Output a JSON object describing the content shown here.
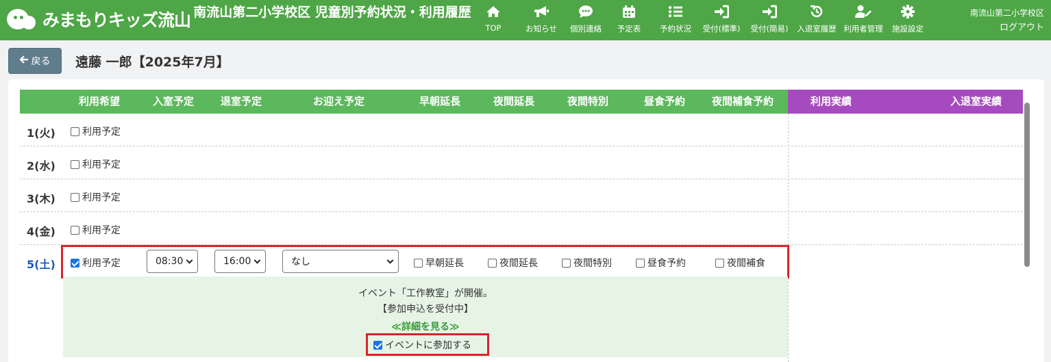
{
  "header": {
    "logo_text": "みまもりキッズ流山",
    "title": "南流山第二小学校区 児童別予約状況・利用履歴",
    "nav": [
      {
        "label": "TOP",
        "icon": "home-icon"
      },
      {
        "label": "お知らせ",
        "icon": "megaphone-icon"
      },
      {
        "label": "個別連絡",
        "icon": "chat-icon"
      },
      {
        "label": "予定表",
        "icon": "calendar-icon"
      },
      {
        "label": "予約状況",
        "icon": "list-icon"
      },
      {
        "label": "受付(標準)",
        "icon": "sign-in-icon"
      },
      {
        "label": "受付(簡易)",
        "icon": "sign-in-icon"
      },
      {
        "label": "入退室履歴",
        "icon": "history-icon"
      },
      {
        "label": "利用者管理",
        "icon": "user-edit-icon"
      },
      {
        "label": "施設設定",
        "icon": "gear-icon"
      }
    ],
    "user_area": "南流山第二小学校区",
    "logout": "ログアウト"
  },
  "back_button": "戻る",
  "page_title": "遠藤 一郎【2025年7月】",
  "table": {
    "columns": [
      "利用希望",
      "入室予定",
      "退室予定",
      "お迎え予定",
      "早朝延長",
      "夜間延長",
      "夜間特別",
      "昼食予約",
      "夜間補食予約",
      "利用実績",
      "入退室実績"
    ],
    "rows": [
      {
        "day": "1(火)",
        "checkbox_label": "利用予定",
        "checked": false
      },
      {
        "day": "2(水)",
        "checkbox_label": "利用予定",
        "checked": false
      },
      {
        "day": "3(木)",
        "checkbox_label": "利用予定",
        "checked": false
      },
      {
        "day": "4(金)",
        "checkbox_label": "利用予定",
        "checked": false
      },
      {
        "day": "5(土)",
        "checkbox_label": "利用予定",
        "checked": true,
        "checkin": "08:30",
        "checkout": "16:00",
        "pickup": "なし",
        "options": [
          {
            "label": "早朝延長",
            "checked": false
          },
          {
            "label": "夜間延長",
            "checked": false
          },
          {
            "label": "夜間特別",
            "checked": false
          },
          {
            "label": "昼食予約",
            "checked": false
          },
          {
            "label": "夜間補食",
            "checked": false
          }
        ]
      }
    ]
  },
  "event": {
    "line1": "イベント「工作教室」が開催。",
    "line2": "【参加申込を受付中】",
    "details_link": "≪詳細を見る≫",
    "join_label": "イベントに参加する",
    "join_checked": true
  },
  "colors": {
    "header_bg": "#4ea646",
    "table_header_green": "#5cb85c",
    "table_header_purple": "#a64bbf",
    "highlight_red": "#d9232b",
    "saturday_blue": "#1e5bb8"
  }
}
